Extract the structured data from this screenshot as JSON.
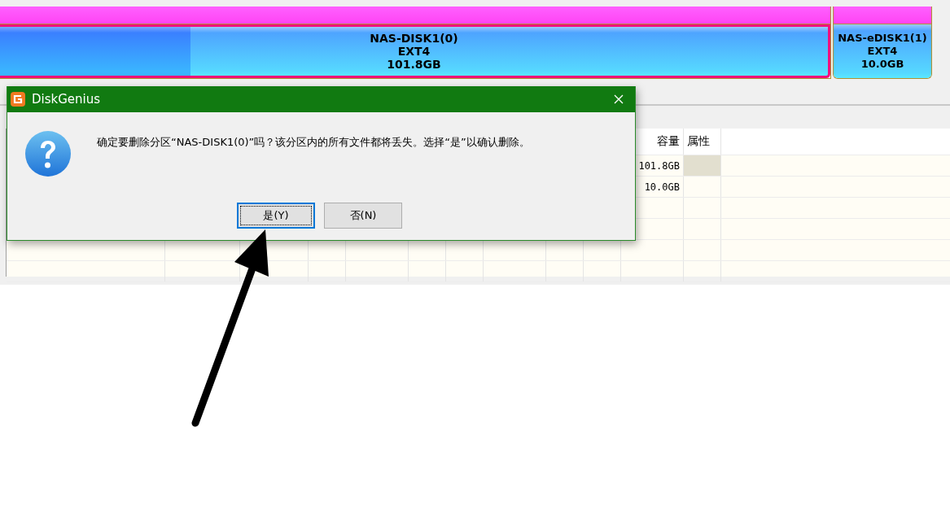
{
  "disk_map": {
    "partitions": [
      {
        "name": "NAS-DISK1(0)",
        "filesystem": "EXT4",
        "size": "101.8GB",
        "selected": true,
        "level": 0.23
      },
      {
        "name": "NAS-eDISK1(1)",
        "filesystem": "EXT4",
        "size": "10.0GB",
        "selected": false
      }
    ]
  },
  "table": {
    "columns": [
      "容量",
      "属性"
    ],
    "rows": [
      {
        "capacity": "101.8GB",
        "selected": true
      },
      {
        "capacity": "10.0GB",
        "selected": false
      }
    ]
  },
  "dialog": {
    "title": "DiskGenius",
    "message": "确定要删除分区“NAS-DISK1(0)”吗？该分区内的所有文件都将丢失。选择“是”以确认删除。",
    "buttons": [
      {
        "label": "是(Y)",
        "focused": true
      },
      {
        "label": "否(N)",
        "focused": false
      }
    ]
  }
}
